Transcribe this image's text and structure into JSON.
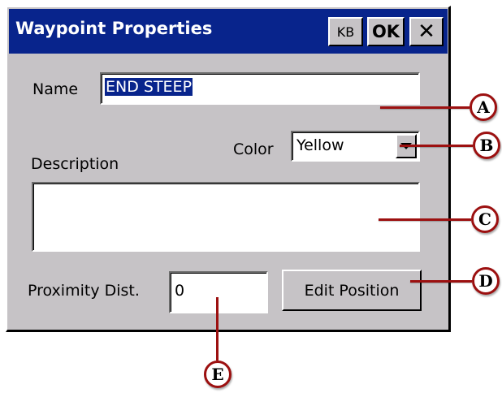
{
  "dialog": {
    "title": "Waypoint Properties",
    "kb_label": "KB",
    "ok_label": "OK",
    "close_glyph": "✕"
  },
  "form": {
    "name_label": "Name",
    "name_value": "END STEEP",
    "color_label": "Color",
    "color_value": "Yellow",
    "description_label": "Description",
    "description_value": "",
    "proximity_label": "Proximity Dist.",
    "proximity_value": "0",
    "edit_position_label": "Edit Position"
  },
  "callouts": [
    "A",
    "B",
    "C",
    "D",
    "E"
  ],
  "colors": {
    "titlebar": "#08248c",
    "dialog_bg": "#c6c3c6",
    "selection": "#08248c",
    "callout": "#9c1010"
  }
}
